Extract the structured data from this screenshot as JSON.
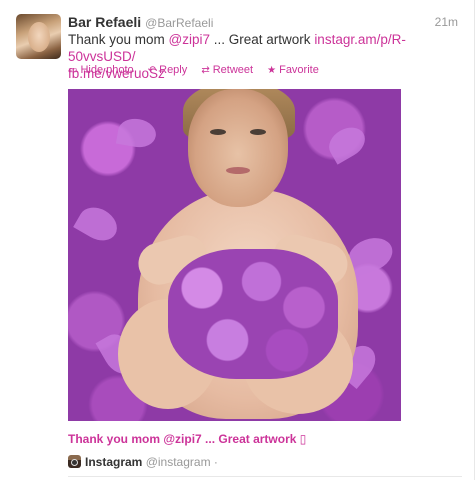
{
  "tweet": {
    "author": {
      "name": "Bar Refaeli",
      "handle": "@BarRefaeli"
    },
    "time": "21m",
    "text": {
      "prefix": "Thank you mom ",
      "mention": "@zipi7",
      "middle": " ... Great artwork ",
      "link1": "instagr.am/p/R-50vvsUSD/",
      "link2": "fb.me/vweruoSz"
    },
    "actions": [
      {
        "icon": "photo-icon",
        "label": "Hide photo"
      },
      {
        "icon": "reply-icon",
        "label": "Reply"
      },
      {
        "icon": "retweet-icon",
        "label": "Retweet"
      },
      {
        "icon": "star-icon",
        "label": "Favorite"
      }
    ],
    "caption": "Thank you mom @zipi7 ... Great artwork ▯",
    "source": {
      "icon": "instagram-icon",
      "name": "Instagram",
      "handle": "@instagram",
      "separator": "·"
    }
  },
  "colors": {
    "link": "#cc3399",
    "text": "#333333",
    "muted": "#999999"
  }
}
